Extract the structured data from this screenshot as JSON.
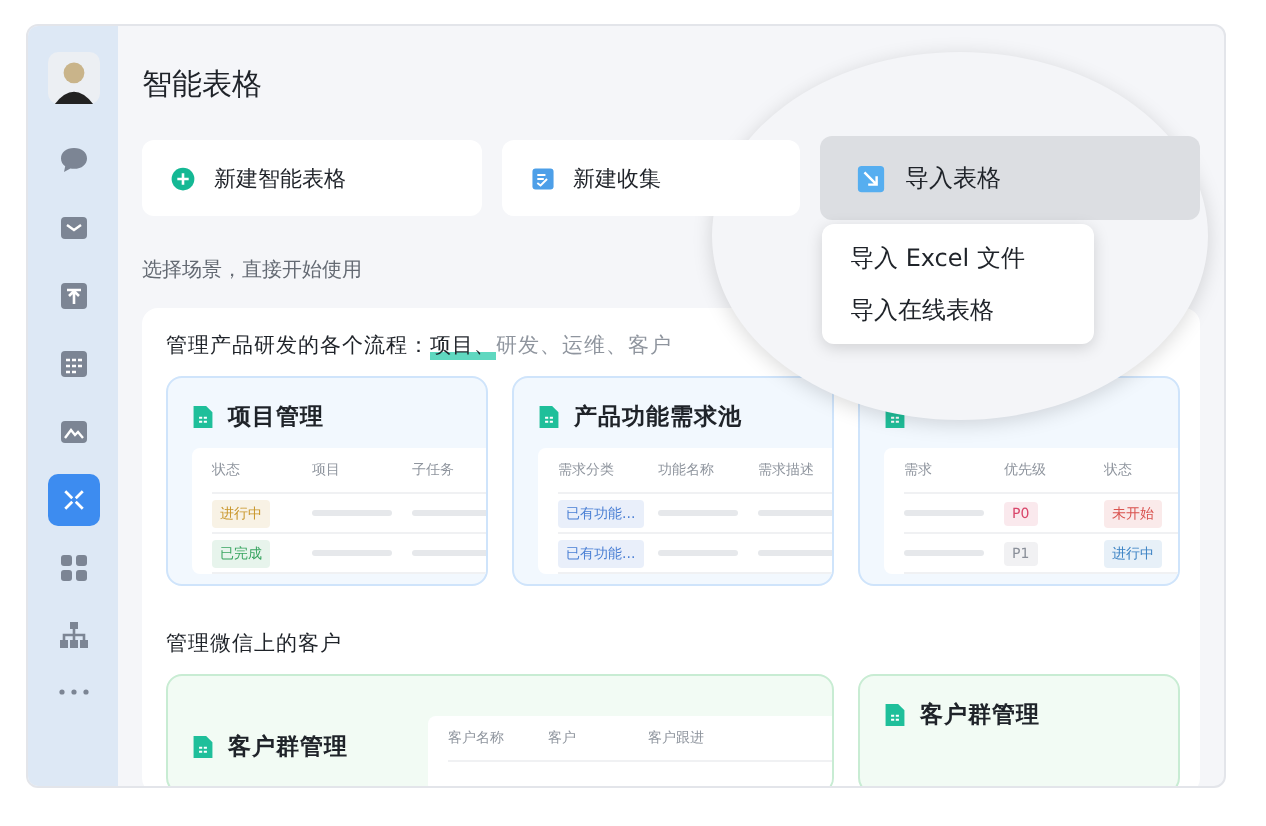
{
  "page_title": "智能表格",
  "create_buttons": [
    {
      "label": "新建智能表格",
      "kind": "add"
    },
    {
      "label": "新建收集",
      "kind": "collect"
    },
    {
      "label": "导入表格",
      "kind": "import"
    }
  ],
  "import_menu": [
    "导入 Excel 文件",
    "导入在线表格"
  ],
  "hint": "选择场景，直接开始使用",
  "sections": [
    {
      "heading": "管理产品研发的各个流程：",
      "tabs": [
        {
          "label": "项目、",
          "selected": true
        },
        {
          "label": "研发、",
          "selected": false
        },
        {
          "label": "运维、",
          "selected": false
        },
        {
          "label": "客户",
          "selected": false
        }
      ],
      "cards": [
        {
          "title": "项目管理",
          "wide": false,
          "columns": [
            "状态",
            "项目",
            "子任务"
          ],
          "rows": [
            [
              {
                "kind": "tag",
                "text": "进行中",
                "color": "#c9962b"
              },
              {
                "kind": "bar"
              },
              {
                "kind": "bar"
              }
            ],
            [
              {
                "kind": "tag",
                "text": "已完成",
                "color": "#3aa561"
              },
              {
                "kind": "bar"
              },
              {
                "kind": "bar"
              }
            ]
          ]
        },
        {
          "title": "产品功能需求池",
          "wide": false,
          "columns": [
            "需求分类",
            "功能名称",
            "需求描述"
          ],
          "rows": [
            [
              {
                "kind": "tag",
                "text": "已有功能...",
                "color": "#4a7fd4"
              },
              {
                "kind": "bar"
              },
              {
                "kind": "bar"
              }
            ],
            [
              {
                "kind": "tag",
                "text": "已有功能...",
                "color": "#4a7fd4"
              },
              {
                "kind": "bar"
              },
              {
                "kind": "bar"
              }
            ]
          ]
        },
        {
          "wide": false,
          "columns": [
            "需求",
            "优先级",
            "状态"
          ],
          "rows": [
            [
              {
                "kind": "bar"
              },
              {
                "kind": "tag",
                "text": "P0",
                "color": "#d9466a"
              },
              {
                "kind": "tag",
                "text": "未开始",
                "color": "#d9534f"
              }
            ],
            [
              {
                "kind": "bar"
              },
              {
                "kind": "tag",
                "text": "P1",
                "color": "#8a8f99"
              },
              {
                "kind": "tag",
                "text": "进行中",
                "color": "#3b82c4"
              }
            ]
          ]
        }
      ]
    },
    {
      "heading": "管理微信上的客户",
      "cards": [
        {
          "title": "客户群管理",
          "wide": true,
          "columns": [
            "客户名称",
            "客户",
            "客户跟进"
          ]
        },
        {
          "title": "客户群管理",
          "wide": false
        }
      ]
    }
  ]
}
